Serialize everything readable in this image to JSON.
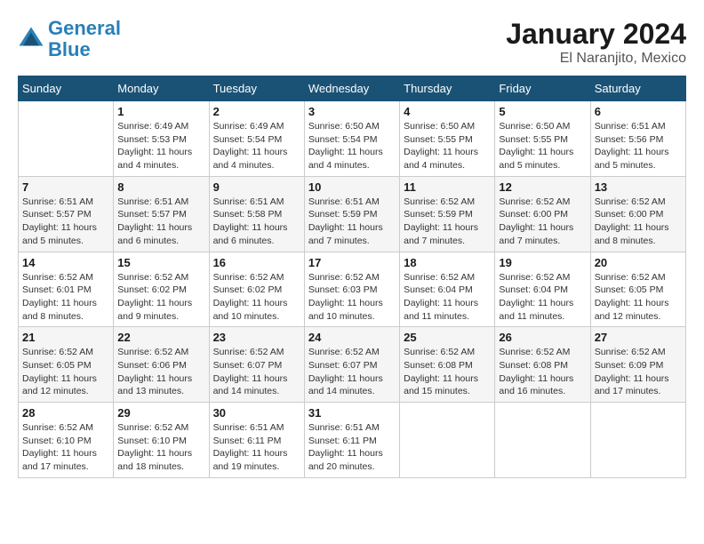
{
  "header": {
    "logo_line1": "General",
    "logo_line2": "Blue",
    "month": "January 2024",
    "location": "El Naranjito, Mexico"
  },
  "weekdays": [
    "Sunday",
    "Monday",
    "Tuesday",
    "Wednesday",
    "Thursday",
    "Friday",
    "Saturday"
  ],
  "weeks": [
    [
      {
        "day": "",
        "info": ""
      },
      {
        "day": "1",
        "info": "Sunrise: 6:49 AM\nSunset: 5:53 PM\nDaylight: 11 hours\nand 4 minutes."
      },
      {
        "day": "2",
        "info": "Sunrise: 6:49 AM\nSunset: 5:54 PM\nDaylight: 11 hours\nand 4 minutes."
      },
      {
        "day": "3",
        "info": "Sunrise: 6:50 AM\nSunset: 5:54 PM\nDaylight: 11 hours\nand 4 minutes."
      },
      {
        "day": "4",
        "info": "Sunrise: 6:50 AM\nSunset: 5:55 PM\nDaylight: 11 hours\nand 4 minutes."
      },
      {
        "day": "5",
        "info": "Sunrise: 6:50 AM\nSunset: 5:55 PM\nDaylight: 11 hours\nand 5 minutes."
      },
      {
        "day": "6",
        "info": "Sunrise: 6:51 AM\nSunset: 5:56 PM\nDaylight: 11 hours\nand 5 minutes."
      }
    ],
    [
      {
        "day": "7",
        "info": "Sunrise: 6:51 AM\nSunset: 5:57 PM\nDaylight: 11 hours\nand 5 minutes."
      },
      {
        "day": "8",
        "info": "Sunrise: 6:51 AM\nSunset: 5:57 PM\nDaylight: 11 hours\nand 6 minutes."
      },
      {
        "day": "9",
        "info": "Sunrise: 6:51 AM\nSunset: 5:58 PM\nDaylight: 11 hours\nand 6 minutes."
      },
      {
        "day": "10",
        "info": "Sunrise: 6:51 AM\nSunset: 5:59 PM\nDaylight: 11 hours\nand 7 minutes."
      },
      {
        "day": "11",
        "info": "Sunrise: 6:52 AM\nSunset: 5:59 PM\nDaylight: 11 hours\nand 7 minutes."
      },
      {
        "day": "12",
        "info": "Sunrise: 6:52 AM\nSunset: 6:00 PM\nDaylight: 11 hours\nand 7 minutes."
      },
      {
        "day": "13",
        "info": "Sunrise: 6:52 AM\nSunset: 6:00 PM\nDaylight: 11 hours\nand 8 minutes."
      }
    ],
    [
      {
        "day": "14",
        "info": "Sunrise: 6:52 AM\nSunset: 6:01 PM\nDaylight: 11 hours\nand 8 minutes."
      },
      {
        "day": "15",
        "info": "Sunrise: 6:52 AM\nSunset: 6:02 PM\nDaylight: 11 hours\nand 9 minutes."
      },
      {
        "day": "16",
        "info": "Sunrise: 6:52 AM\nSunset: 6:02 PM\nDaylight: 11 hours\nand 10 minutes."
      },
      {
        "day": "17",
        "info": "Sunrise: 6:52 AM\nSunset: 6:03 PM\nDaylight: 11 hours\nand 10 minutes."
      },
      {
        "day": "18",
        "info": "Sunrise: 6:52 AM\nSunset: 6:04 PM\nDaylight: 11 hours\nand 11 minutes."
      },
      {
        "day": "19",
        "info": "Sunrise: 6:52 AM\nSunset: 6:04 PM\nDaylight: 11 hours\nand 11 minutes."
      },
      {
        "day": "20",
        "info": "Sunrise: 6:52 AM\nSunset: 6:05 PM\nDaylight: 11 hours\nand 12 minutes."
      }
    ],
    [
      {
        "day": "21",
        "info": "Sunrise: 6:52 AM\nSunset: 6:05 PM\nDaylight: 11 hours\nand 12 minutes."
      },
      {
        "day": "22",
        "info": "Sunrise: 6:52 AM\nSunset: 6:06 PM\nDaylight: 11 hours\nand 13 minutes."
      },
      {
        "day": "23",
        "info": "Sunrise: 6:52 AM\nSunset: 6:07 PM\nDaylight: 11 hours\nand 14 minutes."
      },
      {
        "day": "24",
        "info": "Sunrise: 6:52 AM\nSunset: 6:07 PM\nDaylight: 11 hours\nand 14 minutes."
      },
      {
        "day": "25",
        "info": "Sunrise: 6:52 AM\nSunset: 6:08 PM\nDaylight: 11 hours\nand 15 minutes."
      },
      {
        "day": "26",
        "info": "Sunrise: 6:52 AM\nSunset: 6:08 PM\nDaylight: 11 hours\nand 16 minutes."
      },
      {
        "day": "27",
        "info": "Sunrise: 6:52 AM\nSunset: 6:09 PM\nDaylight: 11 hours\nand 17 minutes."
      }
    ],
    [
      {
        "day": "28",
        "info": "Sunrise: 6:52 AM\nSunset: 6:10 PM\nDaylight: 11 hours\nand 17 minutes."
      },
      {
        "day": "29",
        "info": "Sunrise: 6:52 AM\nSunset: 6:10 PM\nDaylight: 11 hours\nand 18 minutes."
      },
      {
        "day": "30",
        "info": "Sunrise: 6:51 AM\nSunset: 6:11 PM\nDaylight: 11 hours\nand 19 minutes."
      },
      {
        "day": "31",
        "info": "Sunrise: 6:51 AM\nSunset: 6:11 PM\nDaylight: 11 hours\nand 20 minutes."
      },
      {
        "day": "",
        "info": ""
      },
      {
        "day": "",
        "info": ""
      },
      {
        "day": "",
        "info": ""
      }
    ]
  ]
}
